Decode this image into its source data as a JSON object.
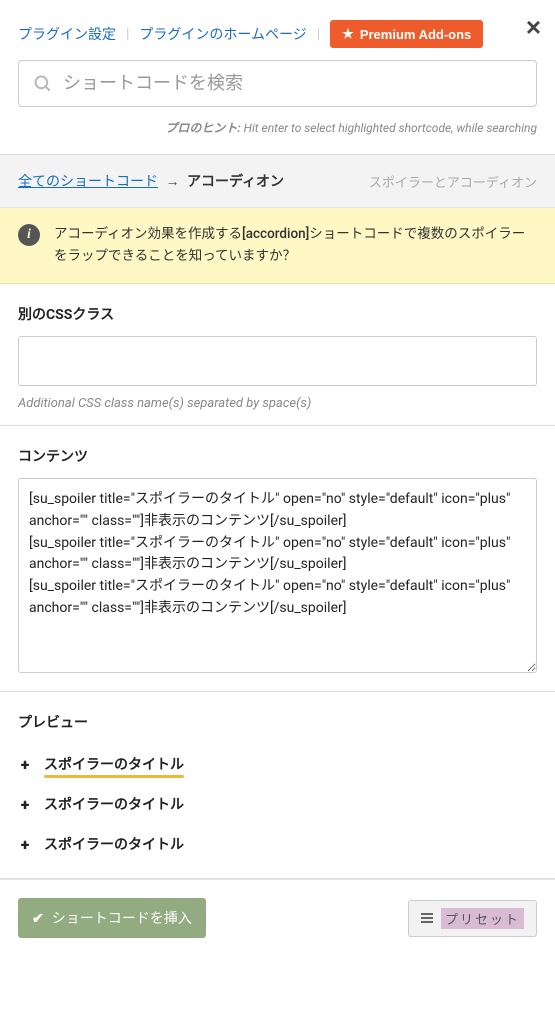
{
  "header": {
    "link_settings": "プラグイン設定",
    "link_homepage": "プラグインのホームページ",
    "premium_button": "Premium Add-ons"
  },
  "search": {
    "placeholder": "ショートコードを検索"
  },
  "hint": {
    "label": "プロのヒント:",
    "text": " Hit enter to select highlighted shortcode, while searching"
  },
  "breadcrumb": {
    "all": "全てのショートコード",
    "current": "アコーディオン",
    "meta": "スポイラーとアコーディオン"
  },
  "info_banner": "アコーディオン効果を作成する[accordion]ショートコードで複数のスポイラーをラップできることを知っていますか？",
  "css_section": {
    "label": "別のCSSクラス",
    "value": "",
    "hint": "Additional CSS class name(s) separated by space(s)"
  },
  "content_section": {
    "label": "コンテンツ",
    "value": "[su_spoiler title=\"スポイラーのタイトル\" open=\"no\" style=\"default\" icon=\"plus\" anchor=\"\" class=\"\"]非表示のコンテンツ[/su_spoiler]\n[su_spoiler title=\"スポイラーのタイトル\" open=\"no\" style=\"default\" icon=\"plus\" anchor=\"\" class=\"\"]非表示のコンテンツ[/su_spoiler]\n[su_spoiler title=\"スポイラーのタイトル\" open=\"no\" style=\"default\" icon=\"plus\" anchor=\"\" class=\"\"]非表示のコンテンツ[/su_spoiler]"
  },
  "preview": {
    "label": "プレビュー",
    "items": [
      {
        "title": "スポイラーのタイトル",
        "highlight": true
      },
      {
        "title": "スポイラーのタイトル",
        "highlight": false
      },
      {
        "title": "スポイラーのタイトル",
        "highlight": false
      }
    ]
  },
  "footer": {
    "insert": "ショートコードを挿入",
    "preset": "プリセット"
  }
}
